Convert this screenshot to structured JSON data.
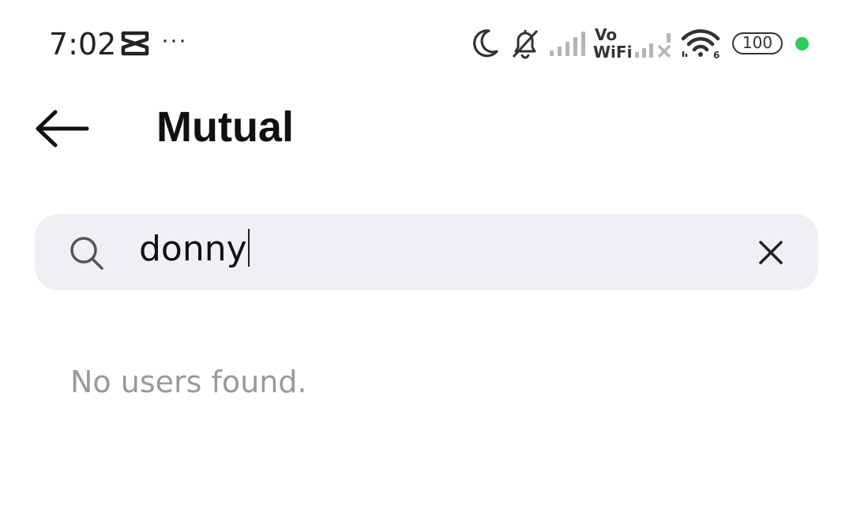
{
  "status_bar": {
    "time": "7:02",
    "more": "···",
    "vo": "Vo",
    "wifi_label": "WiFi",
    "wifi_sub": "6",
    "battery": "100",
    "dot_color": "#2ecc5b",
    "icons": [
      "capcut-icon",
      "moon-icon",
      "bell-off-icon",
      "signal-icon",
      "vowifi-icon",
      "signal-off-icon",
      "wifi-icon",
      "battery-icon"
    ]
  },
  "header": {
    "back_icon": "arrow-left-icon",
    "title": "Mutual"
  },
  "search": {
    "icon": "search-icon",
    "value": "donny",
    "clear_icon": "close-icon"
  },
  "results": {
    "empty_message": "No users found."
  }
}
